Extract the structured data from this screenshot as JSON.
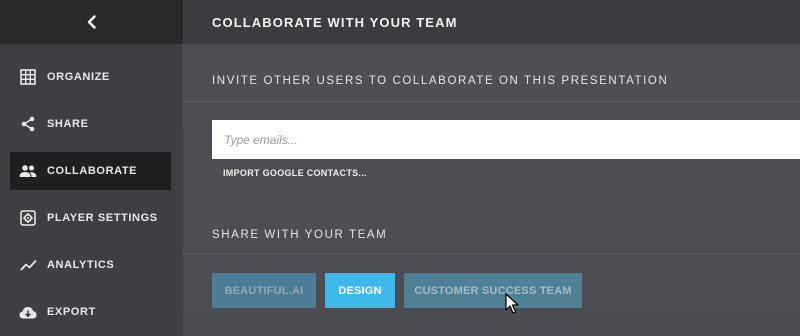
{
  "sidebar": {
    "back_label": "back",
    "items": [
      {
        "label": "ORGANIZE",
        "icon": "grid-icon",
        "active": false
      },
      {
        "label": "SHARE",
        "icon": "share-icon",
        "active": false
      },
      {
        "label": "COLLABORATE",
        "icon": "people-icon",
        "active": true
      },
      {
        "label": "PLAYER SETTINGS",
        "icon": "player-settings-icon",
        "active": false
      },
      {
        "label": "ANALYTICS",
        "icon": "trend-icon",
        "active": false
      },
      {
        "label": "EXPORT",
        "icon": "cloud-download-icon",
        "active": false
      }
    ]
  },
  "header": {
    "title": "COLLABORATE WITH YOUR TEAM"
  },
  "invite": {
    "heading": "INVITE OTHER USERS TO COLLABORATE ON THIS PRESENTATION",
    "email_placeholder": "Type emails...",
    "email_value": "",
    "import_label": "IMPORT GOOGLE CONTACTS..."
  },
  "team": {
    "heading": "SHARE WITH YOUR TEAM",
    "buttons": [
      {
        "label": "BEAUTIFUL.AI",
        "state": "dim"
      },
      {
        "label": "DESIGN",
        "state": "selected"
      },
      {
        "label": "CUSTOMER SUCCESS TEAM",
        "state": "hover"
      }
    ]
  },
  "colors": {
    "sidebar_bg": "#3f3f43",
    "sidebar_top_bg": "#2a2a2c",
    "active_item_bg": "#1f1f21",
    "main_bg": "#4d4e54",
    "topbar_bg": "#3b3c40",
    "button_dim": "#4d7d94",
    "button_selected": "#3dbaeb",
    "button_hover": "#4f8096"
  }
}
